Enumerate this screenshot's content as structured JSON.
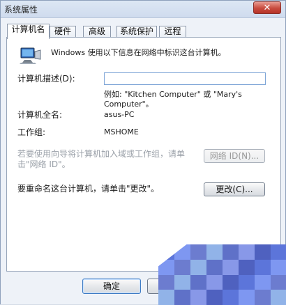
{
  "window": {
    "title": "系统属性",
    "close_symbol": "✕"
  },
  "tabs": [
    {
      "label": "计算机名",
      "active": true
    },
    {
      "label": "硬件",
      "active": false
    },
    {
      "label": "高级",
      "active": false
    },
    {
      "label": "系统保护",
      "active": false
    },
    {
      "label": "远程",
      "active": false
    }
  ],
  "computer_name_tab": {
    "intro": "Windows 使用以下信息在网络中标识这台计算机。",
    "description_label": "计算机描述(D):",
    "description_value": "",
    "example_line1": "例如: \"Kitchen Computer\" 或 \"Mary's",
    "example_line2": "Computer\"。",
    "full_name_label": "计算机全名:",
    "full_name_value": "asus-PC",
    "workgroup_label": "工作组:",
    "workgroup_value": "MSHOME",
    "network_text_line1": "若要使用向导将计算机加入域或工作组，请单",
    "network_text_line2": "击\"网络 ID\"。",
    "network_id_button": "网络 ID(N)...",
    "rename_text": "要重命名这台计算机，请单击\"更改\"。",
    "change_button": "更改(C)..."
  },
  "footer": {
    "ok_button": "确定"
  },
  "icons": {
    "computer": "computer-icon",
    "close": "close-icon"
  },
  "colors": {
    "accent": "#3d7bc5",
    "close_red": "#c84b3f",
    "mosaic_blue": "#6c7ccf"
  }
}
